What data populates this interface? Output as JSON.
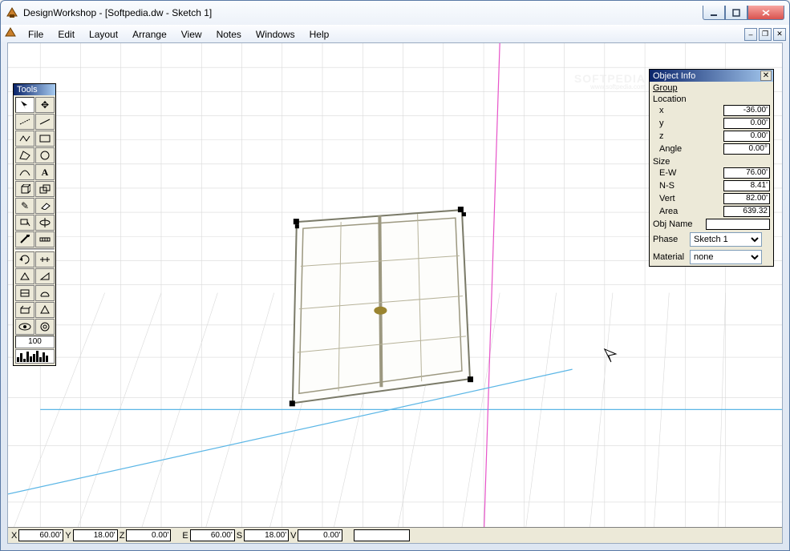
{
  "app": {
    "title": "DesignWorkshop - [Softpedia.dw - Sketch 1]"
  },
  "menu": {
    "items": [
      "File",
      "Edit",
      "Layout",
      "Arrange",
      "View",
      "Notes",
      "Windows",
      "Help"
    ]
  },
  "tools": {
    "title": "Tools",
    "zoom_value": "100"
  },
  "object_info": {
    "title": "Object Info",
    "group_label": "Group",
    "location_label": "Location",
    "x_label": "x",
    "x": "-36.00'",
    "y_label": "y",
    "y": "0.00'",
    "z_label": "z",
    "z": "0.00'",
    "angle_label": "Angle",
    "angle": "0.00°",
    "size_label": "Size",
    "ew_label": "E-W",
    "ew": "76.00'",
    "ns_label": "N-S",
    "ns": "8.41'",
    "vert_label": "Vert",
    "vert": "82.00'",
    "area_label": "Area",
    "area": "639.32",
    "objname_label": "Obj Name",
    "objname": "",
    "phase_label": "Phase",
    "phase": "Sketch 1",
    "material_label": "Material",
    "material": "none"
  },
  "status": {
    "x_label": "X",
    "x": "60.00'",
    "y_label": "Y",
    "y": "18.00'",
    "z_label": "Z",
    "z": "0.00'",
    "e_label": "E",
    "e": "60.00'",
    "s_label": "S",
    "s": "18.00'",
    "v_label": "V",
    "v": "0.00'",
    "extra": ""
  },
  "watermark": "SOFTPEDIA",
  "watermark_url": "www.softpedia.com"
}
